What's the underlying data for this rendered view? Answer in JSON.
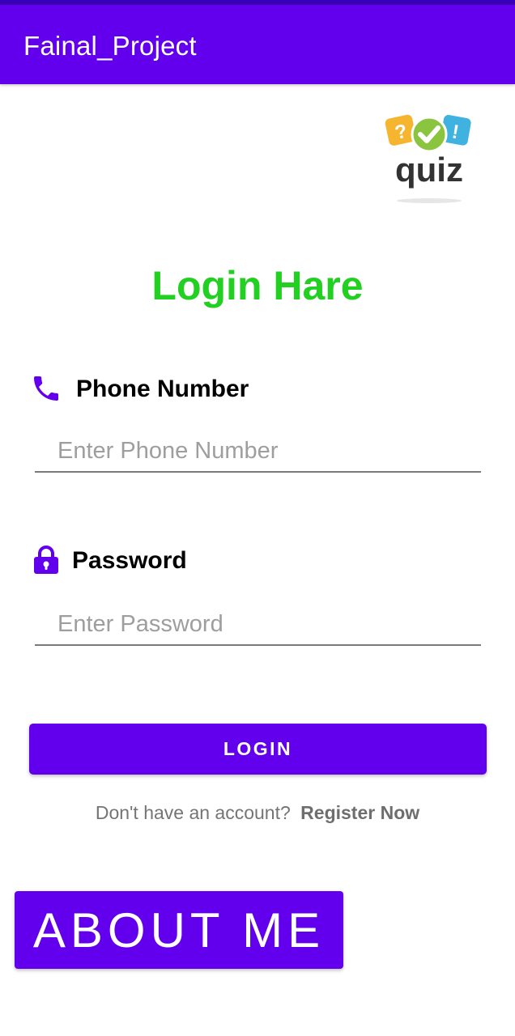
{
  "app_bar": {
    "title": "Fainal_Project",
    "color": "#6200ee"
  },
  "logo": {
    "text": "quiz",
    "icon": "quiz-logo"
  },
  "heading": "Login Hare",
  "phone": {
    "icon": "phone-icon",
    "label": "Phone Number",
    "value": "",
    "placeholder": "Enter Phone Number"
  },
  "password": {
    "icon": "lock-icon",
    "label": "Password",
    "value": "",
    "placeholder": "Enter Password"
  },
  "login_button": {
    "label": "LOGIN"
  },
  "register": {
    "prompt": "Don't have an account?",
    "link": "Register Now"
  },
  "about_button": {
    "label": "ABOUT ME"
  },
  "colors": {
    "primary": "#6200ee",
    "heading": "#22d022"
  }
}
